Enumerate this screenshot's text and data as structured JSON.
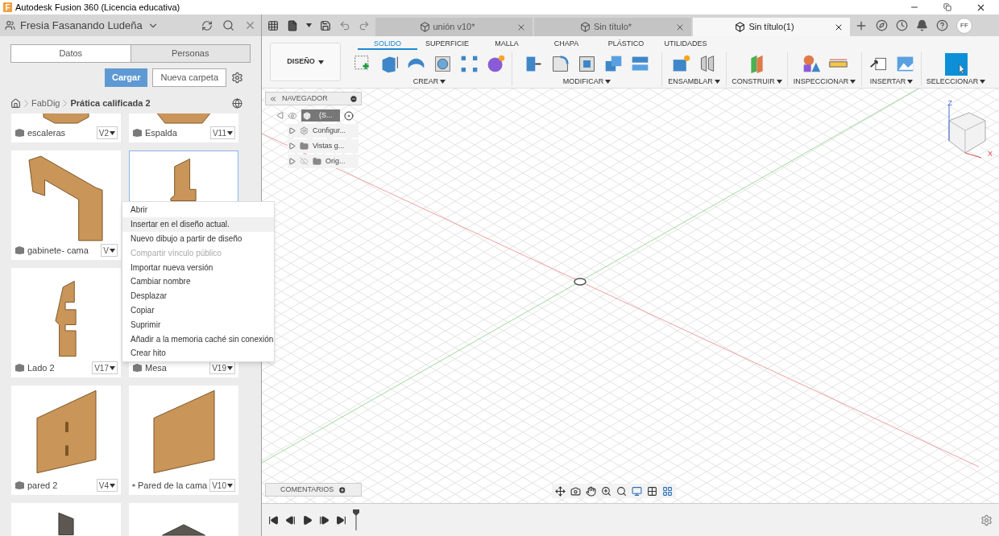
{
  "window": {
    "logo": "F",
    "title": "Autodesk Fusion 360 (Licencia educativa)"
  },
  "data_panel": {
    "user": "Fresia Fasanando Ludeña",
    "tabs": [
      {
        "label": "Datos",
        "selected": true
      },
      {
        "label": "Personas",
        "selected": false
      }
    ],
    "buttons": [
      {
        "label": "Cargar",
        "kind": "primary"
      },
      {
        "label": "Nueva carpeta",
        "kind": "secondary"
      }
    ],
    "breadcrumb": [
      {
        "label": "FabDig",
        "current": false
      },
      {
        "label": "Prática calificada 2",
        "current": true
      }
    ],
    "files": [
      {
        "name": "escaleras",
        "version": "V2",
        "selected": false
      },
      {
        "name": "Espalda",
        "version": "V11",
        "selected": false
      },
      {
        "name": "gabinete- cama",
        "version": "V",
        "selected": false
      },
      {
        "selected": true
      },
      {
        "name": "Lado 2",
        "version": "V17",
        "selected": false
      },
      {
        "name": "Mesa",
        "version": "V19",
        "selected": false
      },
      {
        "name": "pared 2",
        "version": "V4",
        "selected": false
      },
      {
        "name": "Pared de la cama",
        "version": "V10",
        "selected": false
      },
      {
        "selected": false
      },
      {
        "selected": false
      }
    ]
  },
  "context_menu": [
    {
      "label": "Abrir",
      "selected": false,
      "disabled": false
    },
    {
      "label": "Insertar en el diseño actual.",
      "selected": true,
      "disabled": false
    },
    {
      "label": "Nuevo dibujo a partir de diseño",
      "selected": false,
      "disabled": false
    },
    {
      "label": "Compartir vínculo público",
      "selected": false,
      "disabled": true
    },
    {
      "label": "Importar nueva versión",
      "selected": false,
      "disabled": false
    },
    {
      "label": "Cambiar nombre",
      "selected": false,
      "disabled": false
    },
    {
      "label": "Desplazar",
      "selected": false,
      "disabled": false
    },
    {
      "label": "Copiar",
      "selected": false,
      "disabled": false
    },
    {
      "label": "Suprimir",
      "selected": false,
      "disabled": false
    },
    {
      "label": "Añadir a la memoria caché sin conexión",
      "selected": false,
      "disabled": false
    },
    {
      "label": "Crear hito",
      "selected": false,
      "disabled": false
    }
  ],
  "document_tabs": [
    {
      "label": "unión v10*",
      "selected": false
    },
    {
      "label": "Sin título*",
      "selected": false
    },
    {
      "label": "Sin título(1)",
      "selected": true
    }
  ],
  "user_avatar": "FF",
  "ribbon": {
    "workspace": "DISEÑO",
    "tabs": [
      {
        "label": "SOLIDO",
        "selected": true
      },
      {
        "label": "SUPERFICIE",
        "selected": false
      },
      {
        "label": "MALLA",
        "selected": false
      },
      {
        "label": "CHAPA",
        "selected": false
      },
      {
        "label": "PLÁSTICO",
        "selected": false
      },
      {
        "label": "UTILIDADES",
        "selected": false
      }
    ],
    "groups": [
      {
        "label": "CREAR"
      },
      {
        "label": "MODIFICAR"
      },
      {
        "label": "ENSAMBLAR"
      },
      {
        "label": "CONSTRUIR"
      },
      {
        "label": "INSPECCIONAR"
      },
      {
        "label": "INSERTAR"
      },
      {
        "label": "SELECCIONAR"
      }
    ]
  },
  "navigator": {
    "title": "NAVEGADOR",
    "root": {
      "label": "(S...",
      "visible": true,
      "children": [
        {
          "label": "Configur...",
          "kind": "settings"
        },
        {
          "label": "Vistas g...",
          "kind": "folder"
        },
        {
          "label": "Orig...",
          "kind": "folder",
          "visible": false
        }
      ]
    }
  },
  "viewcube": {
    "axes": [
      "Z",
      "X"
    ]
  },
  "comments": {
    "title": "COMENTARIOS"
  }
}
